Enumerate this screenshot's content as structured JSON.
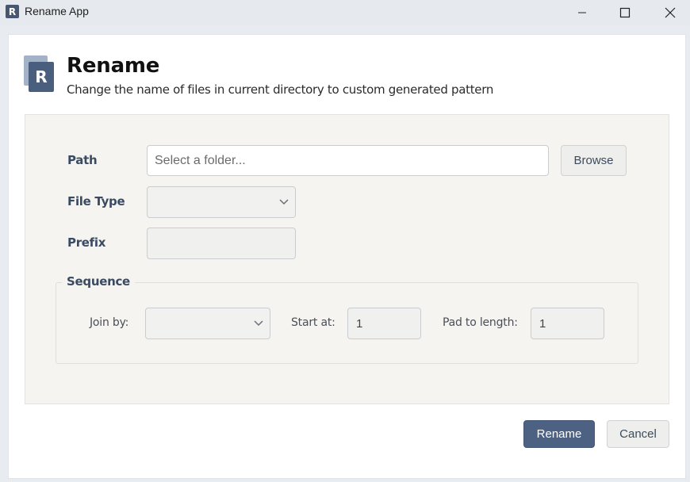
{
  "window": {
    "title": "Rename App",
    "icon_letter": "R"
  },
  "header": {
    "logo_letter": "R",
    "title": "Rename",
    "subtitle": "Change the name of files in current directory to custom generated pattern"
  },
  "form": {
    "path": {
      "label": "Path",
      "placeholder": "Select a folder...",
      "value": "",
      "browse_label": "Browse"
    },
    "file_type": {
      "label": "File Type",
      "selected": ""
    },
    "prefix": {
      "label": "Prefix",
      "value": ""
    },
    "sequence": {
      "legend": "Sequence",
      "join_by_label": "Join by:",
      "join_by_selected": "",
      "start_at_label": "Start at:",
      "start_at_value": "1",
      "pad_label": "Pad to length:",
      "pad_value": "1"
    }
  },
  "actions": {
    "rename_label": "Rename",
    "cancel_label": "Cancel"
  },
  "colors": {
    "accent": "#4d6283",
    "label": "#3a4a60",
    "panel_bg": "#f5f4f1"
  }
}
